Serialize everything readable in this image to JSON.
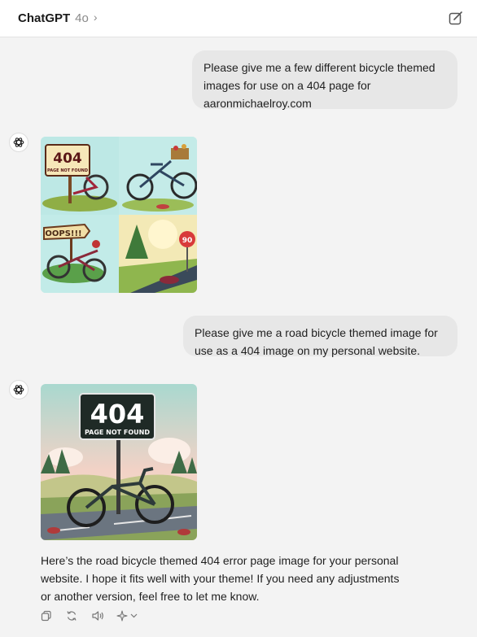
{
  "header": {
    "app_name": "ChatGPT",
    "model": "4o",
    "chevron": "›",
    "new_chat_icon": "compose-icon"
  },
  "messages": [
    {
      "role": "user",
      "lines": [
        "Please give me a few different bicycle themed",
        "images for use on a 404 page for",
        "aaronmichaelroy.com"
      ]
    },
    {
      "role": "assistant",
      "image": {
        "panels": [
          {
            "sign_title": "404",
            "sign_subtitle": "PAGE NOT FOUND"
          },
          {
            "caption": ""
          },
          {
            "sign_title": "OOPS!!!"
          },
          {
            "sign_title": "90"
          }
        ]
      }
    },
    {
      "role": "user",
      "lines": [
        "Please give me a road bicycle themed image for",
        "use as a 404 image on my personal website."
      ]
    },
    {
      "role": "assistant",
      "image": {
        "sign_title": "404",
        "sign_subtitle": "PAGE NOT FOUND"
      },
      "text_lines": [
        "Here’s the road bicycle themed 404 error page image for your personal",
        "website. I hope it fits well with your theme! If you need any adjustments",
        "or another version, feel free to let me know."
      ]
    }
  ],
  "actions": {
    "icons": [
      "copy-icon",
      "regenerate-icon",
      "read-aloud-icon",
      "model-sparkle-icon"
    ]
  },
  "colors": {
    "background": "#f3f3f3",
    "user_bubble": "#e7e7e7",
    "text": "#1f1f1f",
    "muted": "#8a8a8a"
  }
}
